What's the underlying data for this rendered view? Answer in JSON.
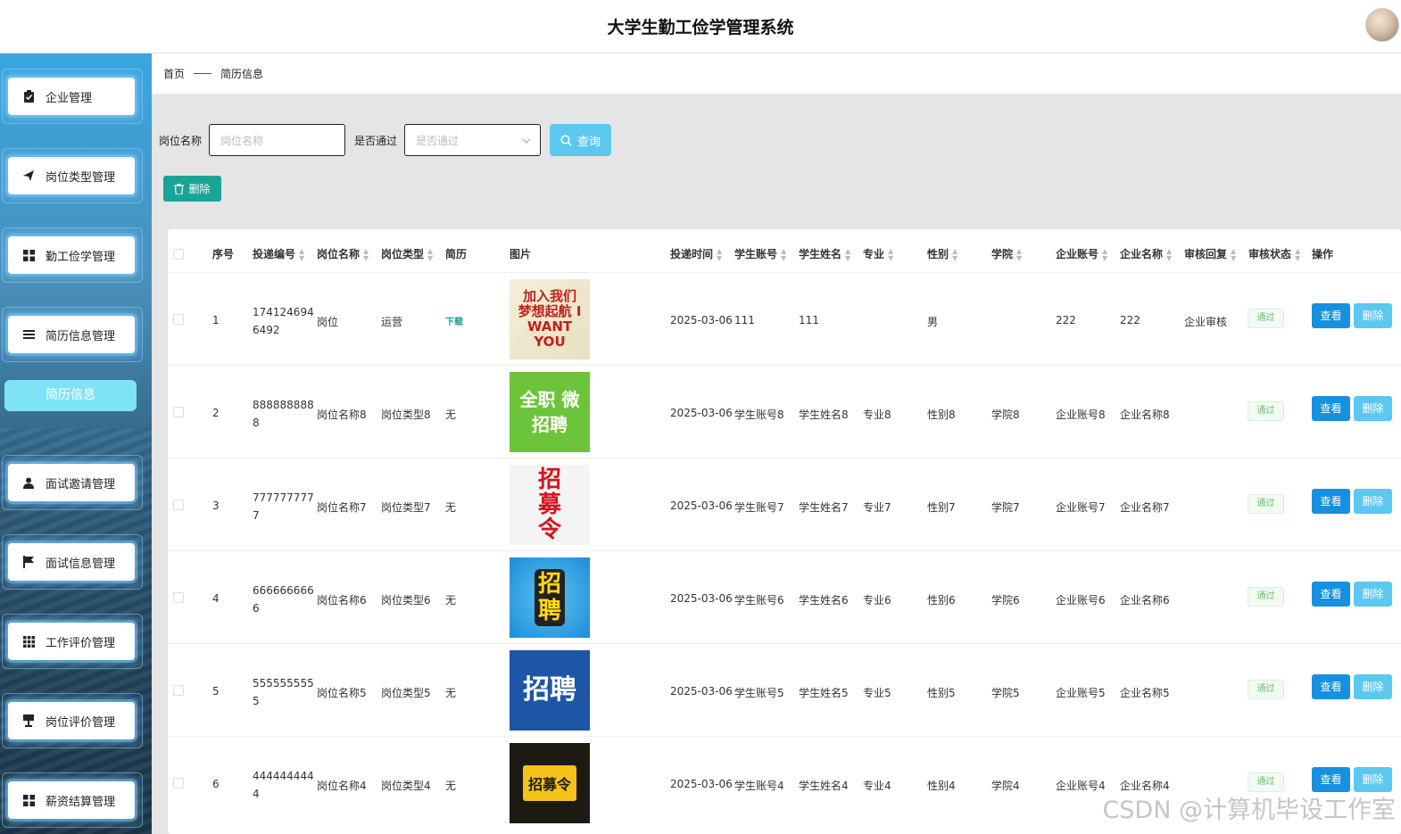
{
  "app": {
    "title": "大学生勤工俭学管理系统"
  },
  "sidebar": {
    "items": [
      {
        "label": "企业管理",
        "icon": "clipboard-icon"
      },
      {
        "label": "岗位类型管理",
        "icon": "paper-plane-icon"
      },
      {
        "label": "勤工俭学管理",
        "icon": "grid-icon"
      },
      {
        "label": "简历信息管理",
        "icon": "list-icon"
      },
      {
        "label": "面试邀请管理",
        "icon": "user-icon"
      },
      {
        "label": "面试信息管理",
        "icon": "flag-icon"
      },
      {
        "label": "工作评价管理",
        "icon": "apps-icon"
      },
      {
        "label": "岗位评价管理",
        "icon": "podium-icon"
      },
      {
        "label": "薪资结算管理",
        "icon": "grid-icon"
      }
    ],
    "submenu_active": "简历信息"
  },
  "breadcrumb": {
    "home": "首页",
    "current": "简历信息"
  },
  "search": {
    "job_label": "岗位名称",
    "job_placeholder": "岗位名称",
    "pass_label": "是否通过",
    "pass_placeholder": "是否通过",
    "query_label": "查询"
  },
  "toolbar": {
    "delete_label": "删除"
  },
  "table": {
    "columns": [
      "序号",
      "投递编号",
      "岗位名称",
      "岗位类型",
      "简历",
      "图片",
      "投递时间",
      "学生账号",
      "学生姓名",
      "专业",
      "性别",
      "学院",
      "企业账号",
      "企业名称",
      "审核回复",
      "审核状态",
      "操作"
    ],
    "rows": [
      {
        "idx": "1",
        "code1": "174124694",
        "code2": "6492",
        "job": "岗位",
        "type": "运营",
        "resume": "下载",
        "image_text": "加入我们 梦想起航 I WANT YOU",
        "time": "2025-03-06",
        "acct": "111",
        "name": "111",
        "major": "",
        "gender": "男",
        "college": "",
        "corp_acct": "222",
        "corp_name": "222",
        "reply": "企业审核",
        "status": "通过"
      },
      {
        "idx": "2",
        "code1": "888888888",
        "code2": "8",
        "job": "岗位名称8",
        "type": "岗位类型8",
        "resume": "无",
        "image_text": "全职 微招聘",
        "time": "2025-03-06",
        "acct": "学生账号8",
        "name": "学生姓名8",
        "major": "专业8",
        "gender": "性别8",
        "college": "学院8",
        "corp_acct": "企业账号8",
        "corp_name": "企业名称8",
        "reply": "",
        "status": "通过"
      },
      {
        "idx": "3",
        "code1": "777777777",
        "code2": "7",
        "job": "岗位名称7",
        "type": "岗位类型7",
        "resume": "无",
        "image_text": "招募令",
        "time": "2025-03-06",
        "acct": "学生账号7",
        "name": "学生姓名7",
        "major": "专业7",
        "gender": "性别7",
        "college": "学院7",
        "corp_acct": "企业账号7",
        "corp_name": "企业名称7",
        "reply": "",
        "status": "通过"
      },
      {
        "idx": "4",
        "code1": "666666666",
        "code2": "6",
        "job": "岗位名称6",
        "type": "岗位类型6",
        "resume": "无",
        "image_text": "招聘",
        "time": "2025-03-06",
        "acct": "学生账号6",
        "name": "学生姓名6",
        "major": "专业6",
        "gender": "性别6",
        "college": "学院6",
        "corp_acct": "企业账号6",
        "corp_name": "企业名称6",
        "reply": "",
        "status": "通过"
      },
      {
        "idx": "5",
        "code1": "555555555",
        "code2": "5",
        "job": "岗位名称5",
        "type": "岗位类型5",
        "resume": "无",
        "image_text": "招聘",
        "time": "2025-03-06",
        "acct": "学生账号5",
        "name": "学生姓名5",
        "major": "专业5",
        "gender": "性别5",
        "college": "学院5",
        "corp_acct": "企业账号5",
        "corp_name": "企业名称5",
        "reply": "",
        "status": "通过"
      },
      {
        "idx": "6",
        "code1": "444444444",
        "code2": "4",
        "job": "岗位名称4",
        "type": "岗位类型4",
        "resume": "无",
        "image_text": "招募令",
        "time": "2025-03-06",
        "acct": "学生账号4",
        "name": "学生姓名4",
        "major": "专业4",
        "gender": "性别4",
        "college": "学院4",
        "corp_acct": "企业账号4",
        "corp_name": "企业名称4",
        "reply": "",
        "status": "通过"
      }
    ],
    "actions": {
      "view": "查看",
      "delete": "删除"
    }
  },
  "watermark": "CSDN @计算机毕设工作室",
  "colors": {
    "primary": "#1890e0",
    "accent": "#5cc8ef",
    "danger_teal": "#1ba398",
    "pass_green": "#6abf70"
  }
}
